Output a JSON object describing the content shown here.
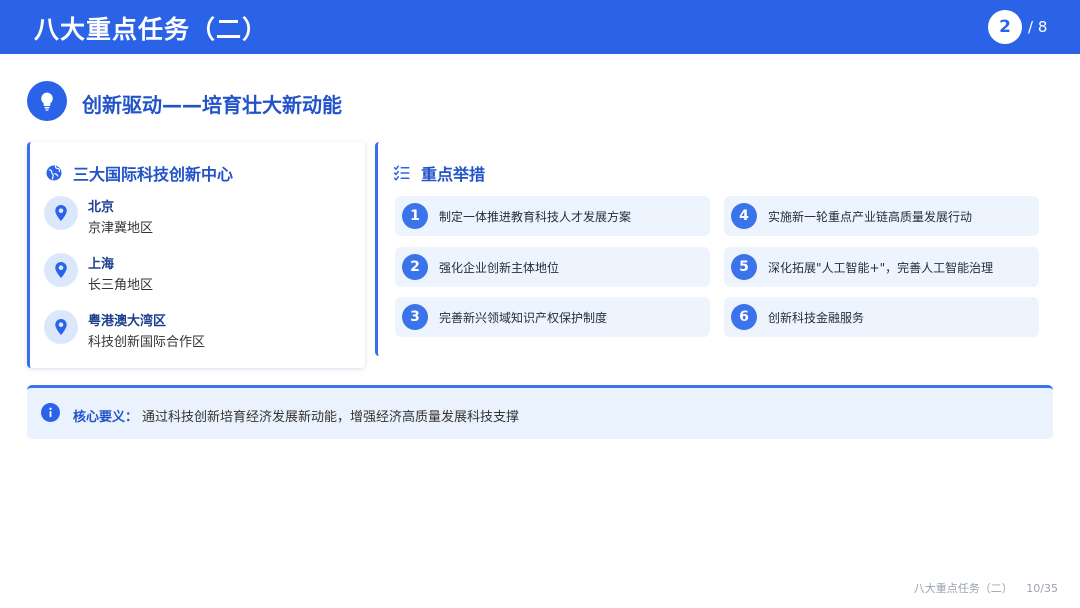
{
  "header": {
    "title": "八大重点任务（二）",
    "page_current": "2",
    "page_total": "/ 8"
  },
  "section": {
    "title": "创新驱动——培育壮大新动能",
    "icon": "lightbulb-icon"
  },
  "centers": {
    "title": "三大国际科技创新中心",
    "icon": "globe-icon",
    "items": [
      {
        "name": "北京",
        "desc": "京津冀地区",
        "icon": "location-pin-icon"
      },
      {
        "name": "上海",
        "desc": "长三角地区",
        "icon": "location-pin-icon"
      },
      {
        "name": "粤港澳大湾区",
        "desc": "科技创新国际合作区",
        "icon": "location-pin-icon"
      }
    ]
  },
  "measures": {
    "title": "重点举措",
    "icon": "checklist-icon",
    "items": [
      {
        "num": "1",
        "text": "制定一体推进教育科技人才发展方案"
      },
      {
        "num": "2",
        "text": "强化企业创新主体地位"
      },
      {
        "num": "3",
        "text": "完善新兴领域知识产权保护制度"
      },
      {
        "num": "4",
        "text": "实施新一轮重点产业链高质量发展行动"
      },
      {
        "num": "5",
        "text": "深化拓展\"人工智能+\"，完善人工智能治理"
      },
      {
        "num": "6",
        "text": "创新科技金融服务"
      }
    ]
  },
  "key": {
    "label": "核心要义：",
    "text": "通过科技创新培育经济发展新动能，增强经济高质量发展科技支撑",
    "icon": "info-icon"
  },
  "footer": {
    "title": "八大重点任务（二）",
    "page": "10/35"
  },
  "colors": {
    "primary": "#2b63e8",
    "accent": "#3b74ea",
    "light_bg": "#eef4fd",
    "title_text": "#2253c9"
  }
}
